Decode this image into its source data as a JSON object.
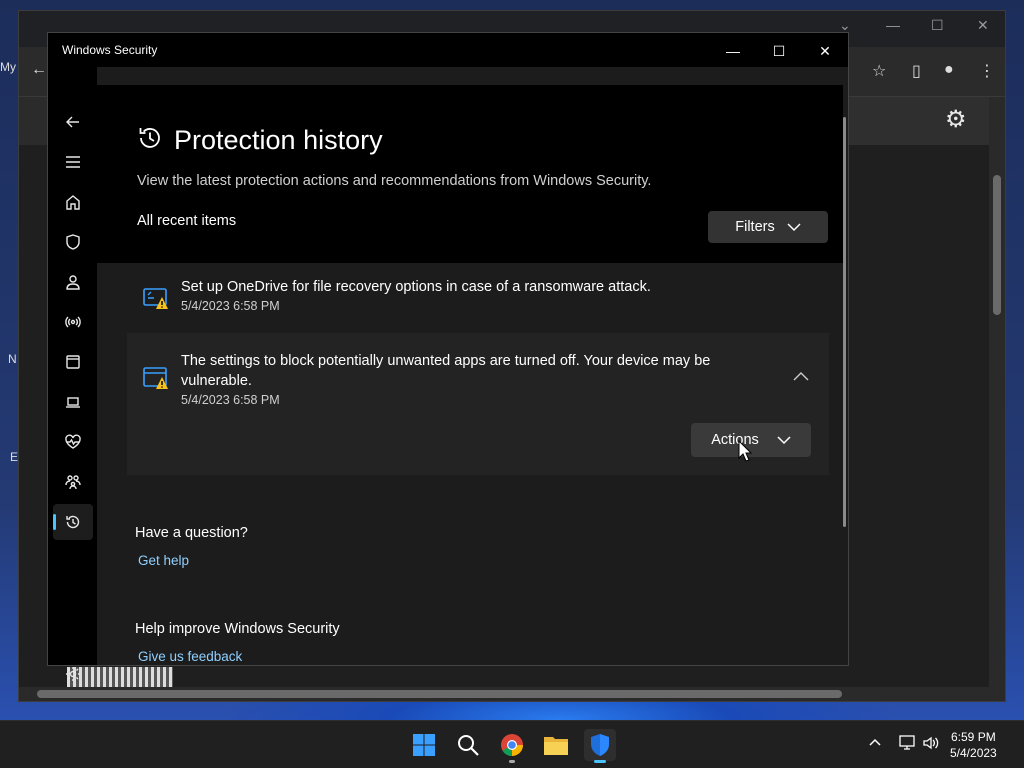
{
  "window": {
    "title": "Windows Security",
    "minimize_icon": "minimize-icon",
    "maximize_icon": "maximize-icon",
    "close_icon": "close-icon"
  },
  "nav": {
    "items": [
      {
        "name": "back",
        "icon": "back-arrow-icon"
      },
      {
        "name": "menu",
        "icon": "hamburger-menu-icon"
      },
      {
        "name": "home",
        "icon": "home-icon"
      },
      {
        "name": "virus-threat-protection",
        "icon": "shield-icon"
      },
      {
        "name": "account-protection",
        "icon": "person-icon"
      },
      {
        "name": "firewall-network",
        "icon": "wireless-signal-icon"
      },
      {
        "name": "app-browser-control",
        "icon": "app-window-icon"
      },
      {
        "name": "device-security",
        "icon": "laptop-icon"
      },
      {
        "name": "device-performance",
        "icon": "heart-pulse-icon"
      },
      {
        "name": "family-options",
        "icon": "family-icon"
      },
      {
        "name": "protection-history",
        "icon": "history-icon",
        "selected": true
      },
      {
        "name": "settings",
        "icon": "gear-icon"
      }
    ]
  },
  "page": {
    "title": "Protection history",
    "description": "View the latest protection actions and recommendations from Windows Security.",
    "section_label": "All recent items",
    "filters_label": "Filters"
  },
  "items": [
    {
      "message": "Set up OneDrive for file recovery options in case of a ransomware attack.",
      "date": "5/4/2023 6:58 PM",
      "icon": "warning-onedrive-icon",
      "expanded": false
    },
    {
      "message_line1": "The settings to block potentially unwanted apps are turned off. Your device may be",
      "message_line2": "vulnerable.",
      "date": "5/4/2023 6:58 PM",
      "icon": "warning-app-icon",
      "expanded": true,
      "actions_label": "Actions"
    }
  ],
  "help": {
    "question_title": "Have a question?",
    "get_help_link": "Get help",
    "improve_title": "Help improve Windows Security",
    "feedback_link": "Give us feedback"
  },
  "background_window": {
    "left_fragments": [
      "My",
      "N",
      "E"
    ]
  },
  "taskbar": {
    "apps": [
      "start-icon",
      "search-icon",
      "chrome-icon",
      "file-explorer-icon",
      "windows-security-icon"
    ],
    "tray_icons": [
      "chevron-up-icon",
      "network-icon",
      "volume-icon"
    ],
    "time": "6:59 PM",
    "date": "5/4/2023"
  },
  "colors": {
    "accent": "#4cc2ff",
    "link": "#8fd0ff",
    "warning": "#f7c21b",
    "icon_blue": "#3aa0ff"
  }
}
